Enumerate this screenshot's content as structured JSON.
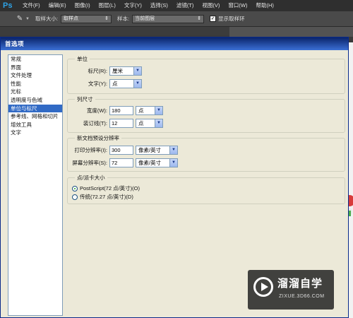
{
  "app": {
    "logo": "Ps",
    "menu": [
      "文件(F)",
      "编辑(E)",
      "图像(I)",
      "图层(L)",
      "文字(Y)",
      "选择(S)",
      "滤镜(T)",
      "视图(V)",
      "窗口(W)",
      "帮助(H)"
    ]
  },
  "options_bar": {
    "tool_icon": "eyedropper-icon",
    "sample_size_label": "取样大小:",
    "sample_size_value": "取样点",
    "sample_label": "样本:",
    "sample_value": "当前图层",
    "show_ring_checked": true,
    "show_ring_label": "显示取样环"
  },
  "dialog": {
    "title": "首选项",
    "nav": [
      "常规",
      "界面",
      "文件处理",
      "性能",
      "光标",
      "透明度与色域",
      "单位与标尺",
      "参考线、网格和切片",
      "增效工具",
      "文字"
    ],
    "nav_selected_index": 6,
    "units": {
      "title": "单位",
      "ruler_label": "标尺(R):",
      "ruler_value": "厘米",
      "type_label": "文字(Y):",
      "type_value": "点"
    },
    "column_size": {
      "title": "列尺寸",
      "width_label": "宽度(W):",
      "width_value": "180",
      "width_unit": "点",
      "gutter_label": "装订线(T):",
      "gutter_value": "12",
      "gutter_unit": "点"
    },
    "new_doc_resolution": {
      "title": "新文档预设分辨率",
      "print_label": "打印分辨率(I):",
      "print_value": "300",
      "print_unit": "像素/英寸",
      "screen_label": "屏幕分辨率(S):",
      "screen_value": "72",
      "screen_unit": "像素/英寸"
    },
    "point_size": {
      "title": "点/派卡大小",
      "option_postscript": "PostScript(72 点/英寸)(O)",
      "option_traditional": "传统(72.27 点/英寸)(D)",
      "selected": "postscript"
    }
  },
  "watermark": {
    "title": "溜溜自学",
    "subtitle": "ZIXUE.3D66.COM"
  }
}
